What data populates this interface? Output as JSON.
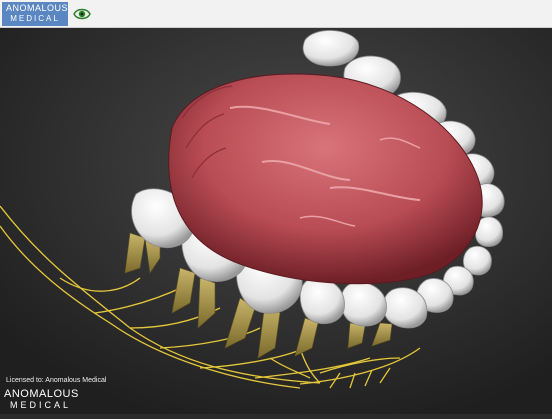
{
  "toolbar": {
    "logo_top": "ANOMALOUS",
    "logo_bottom": "MEDICAL",
    "view_icon": "eye-icon"
  },
  "viewport": {
    "model": "tongue-teeth-nerves-3d-model"
  },
  "footer": {
    "license_text": "Licensed to: Anomalous Medical",
    "brand_top": "ANOMALOUS",
    "brand_bottom": "MEDICAL"
  },
  "colors": {
    "toolbar_bg": "#f2f2f2",
    "logo_bg": "#5a87c2",
    "viewport_bg": "#2b2b2b",
    "tongue": "#c4595f",
    "tooth": "#f2f2f2",
    "nerve": "#e5c83a",
    "root": "#b8a35a",
    "brand_accent": "#d0382d"
  }
}
